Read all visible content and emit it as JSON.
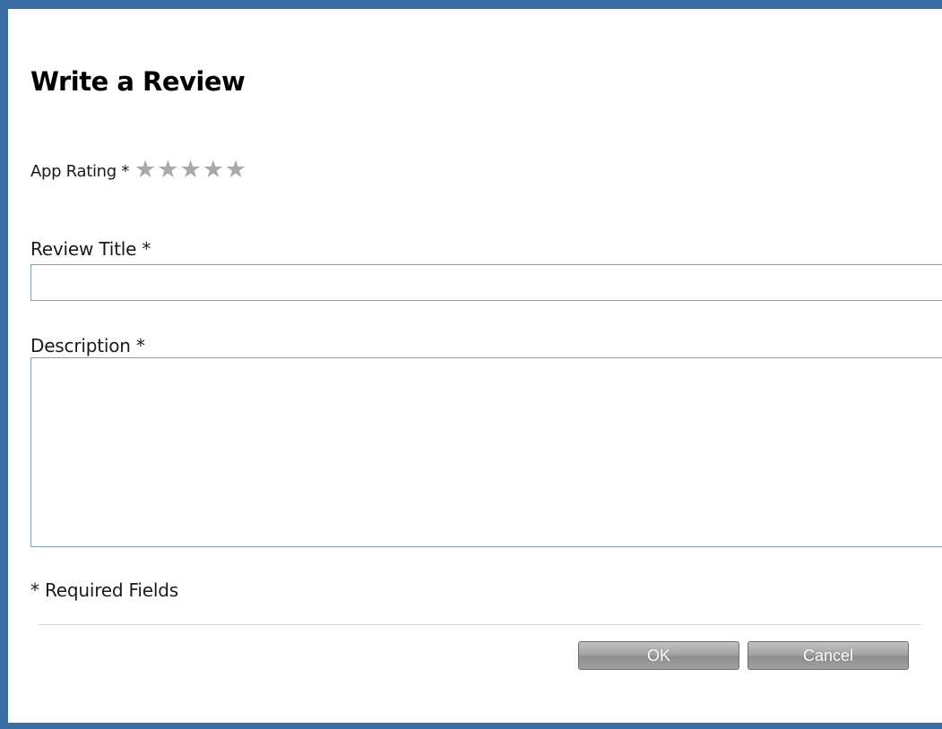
{
  "dialog": {
    "title": "Write a Review",
    "rating": {
      "label": "App Rating *",
      "max": 5,
      "value": 0,
      "star_glyph": "★",
      "empty_color": "#a9a9a9"
    },
    "review_title": {
      "label": "Review Title *",
      "value": "",
      "placeholder": ""
    },
    "description": {
      "label": "Description *",
      "value": "",
      "placeholder": ""
    },
    "required_note": "* Required Fields",
    "buttons": {
      "ok_label": "OK",
      "cancel_label": "Cancel"
    }
  },
  "colors": {
    "frame": "#3a6ea5",
    "input_border": "#7fa1bf",
    "button_gray": "#a4a4a4"
  }
}
